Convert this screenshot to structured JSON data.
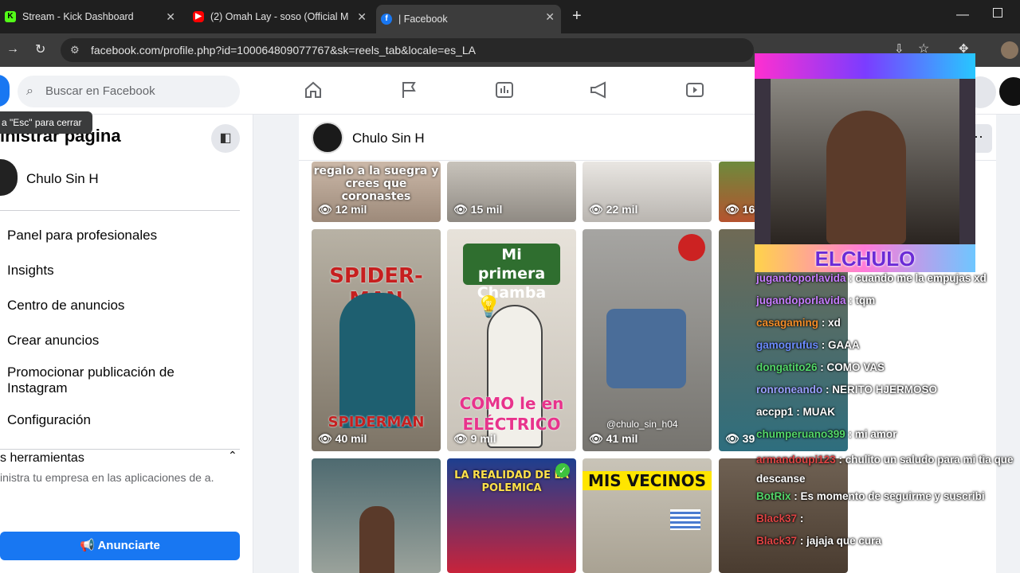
{
  "browser": {
    "tabs": [
      {
        "title": "Stream - Kick Dashboard",
        "icon": "kick-icon"
      },
      {
        "title": "(2) Omah Lay - soso (Official M",
        "icon": "youtube-icon"
      },
      {
        "title": "| Facebook",
        "icon": "facebook-icon"
      }
    ],
    "url": "facebook.com/profile.php?id=100064809077767&sk=reels_tab&locale=es_LA"
  },
  "fb": {
    "search_placeholder": "Buscar en Facebook",
    "tooltip": "a \"Esc\" para cerrar",
    "nav_icons": [
      "home-icon",
      "flag-icon",
      "dashboard-icon",
      "megaphone-icon",
      "video-icon"
    ]
  },
  "sidebar": {
    "title": "inistrar página",
    "page_name": "Chulo Sin H",
    "items": [
      "Panel para profesionales",
      "Insights",
      "Centro de anuncios",
      "Crear anuncios",
      "Promocionar publicación de Instagram",
      "Configuración"
    ],
    "tools_heading": "s herramientas",
    "tools_desc": "inistra tu empresa en las aplicaciones de a.",
    "advertise_button": "Anunciarte"
  },
  "header": {
    "page_name": "Chulo Sin H",
    "more": "···"
  },
  "reels": {
    "row1": [
      {
        "caption": "regalo a la suegra y crees que coronastes",
        "views": "12 mil"
      },
      {
        "caption": "",
        "views": "15 mil"
      },
      {
        "caption": "",
        "views": "22 mil"
      },
      {
        "caption": "",
        "views": "16"
      }
    ],
    "row2": [
      {
        "caption_top": "SPIDER-MAN",
        "caption_bottom": "SPIDERMAN",
        "views": "40 mil"
      },
      {
        "caption_top": "Mi primera Chamba",
        "caption_bottom": "COMO le en ELÉCTRICO",
        "views": "9 mil"
      },
      {
        "caption_top": "",
        "caption_bottom": "@chulo_sin_h04",
        "views": "41 mil"
      },
      {
        "caption_top": "",
        "caption_bottom": "",
        "views": "39"
      }
    ],
    "row3": [
      {
        "caption": ""
      },
      {
        "caption": "LA REALIDAD DE LA POLEMICA"
      },
      {
        "caption": "MIS VECINOS"
      },
      {
        "caption": ""
      }
    ]
  },
  "overlay": {
    "banner": "ELCHULO",
    "chat": [
      {
        "user": "jugandoporlavida",
        "msg": ": cuando me la empujas xd",
        "color": "#c77dff"
      },
      {
        "user": "jugandoporlavida",
        "msg": ": tqm",
        "color": "#c77dff"
      },
      {
        "user": "casagaming",
        "msg": ": xd",
        "color": "#f28c28"
      },
      {
        "user": "gamogrufus",
        "msg": ": GAAA",
        "color": "#6c8cff"
      },
      {
        "user": "dongatito26",
        "msg": ": COMO VAS",
        "color": "#53d769"
      },
      {
        "user": "ronroneando",
        "msg": ": NERITO HJERMOSO",
        "color": "#9aa0ff"
      },
      {
        "user": "accpp1",
        "msg": ": MUAK",
        "color": "#ffffff"
      },
      {
        "user": "chumperuano399",
        "msg": ": mi amor",
        "color": "#53d769"
      },
      {
        "user": "armandoupi123",
        "msg": ": chulito un saludo para mi tia que descanse",
        "color": "#e04444"
      },
      {
        "user": "BotRix",
        "msg": ": Es momento de seguirme y suscribi",
        "color": "#53d769"
      },
      {
        "user": "Black37",
        "msg": ":",
        "color": "#e04444"
      },
      {
        "user": "Black37",
        "msg": ": jajaja que cura",
        "color": "#e04444"
      }
    ]
  }
}
